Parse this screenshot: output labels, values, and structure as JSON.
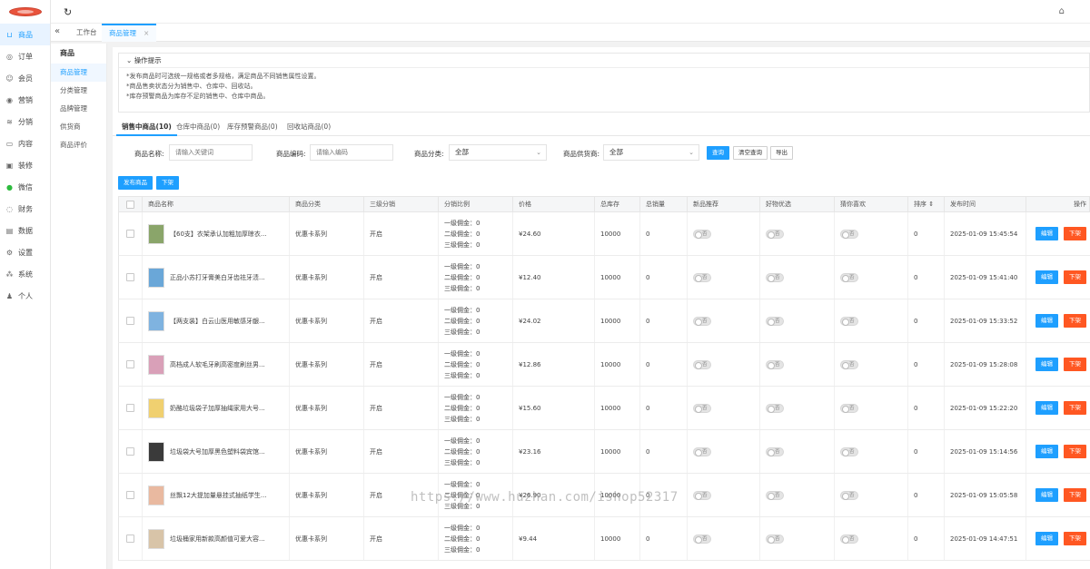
{
  "main_nav": [
    {
      "label": "商品",
      "icon": "cart-icon",
      "active": true
    },
    {
      "label": "订单",
      "icon": "bell-icon"
    },
    {
      "label": "会员",
      "icon": "user-icon"
    },
    {
      "label": "营销",
      "icon": "target-icon"
    },
    {
      "label": "分销",
      "icon": "layers-icon"
    },
    {
      "label": "内容",
      "icon": "book-icon"
    },
    {
      "label": "装修",
      "icon": "monitor-icon"
    },
    {
      "label": "微信",
      "icon": "wechat-icon"
    },
    {
      "label": "财务",
      "icon": "finance-icon"
    },
    {
      "label": "数据",
      "icon": "chart-icon"
    },
    {
      "label": "设置",
      "icon": "gear-icon"
    },
    {
      "label": "系统",
      "icon": "system-icon"
    },
    {
      "label": "个人",
      "icon": "person-icon"
    }
  ],
  "sub_nav": {
    "title": "商品",
    "items": [
      {
        "label": "商品管理",
        "active": true
      },
      {
        "label": "分类管理"
      },
      {
        "label": "品牌管理"
      },
      {
        "label": "供货商"
      },
      {
        "label": "商品评价"
      }
    ]
  },
  "tabs": {
    "home": "工作台",
    "current": "商品管理",
    "close": "×"
  },
  "tips": {
    "title": "操作提示",
    "lines": [
      "*发布商品时可选统一规格或者多规格，满足商品不同销售属性设置。",
      "*商品售卖状态分为销售中、仓库中、回收站。",
      "*库存预警商品为库存不足的销售中、仓库中商品。"
    ]
  },
  "status_tabs": [
    "销售中商品(10)",
    "仓库中商品(0)",
    "库存预警商品(0)",
    "回收站商品(0)"
  ],
  "filters": {
    "name_label": "商品名称:",
    "name_placeholder": "请输入关键词",
    "code_label": "商品编码:",
    "code_placeholder": "请输入编码",
    "category_label": "商品分类:",
    "category_value": "全部",
    "supplier_label": "商品供货商:",
    "supplier_value": "全部",
    "search": "查询",
    "clear": "清空查询",
    "export": "导出"
  },
  "actions": {
    "publish": "发布商品",
    "offshelf": "下架"
  },
  "columns": [
    "商品名称",
    "商品分类",
    "三级分销",
    "分销比例",
    "价格",
    "总库存",
    "总销量",
    "新品推荐",
    "好物优选",
    "猜你喜欢",
    "排序",
    "发布时间",
    "操作"
  ],
  "row_common": {
    "ratio": [
      "一级佣金：0",
      "二级佣金：0",
      "三级佣金：0"
    ],
    "toggle": "否",
    "edit": "编辑",
    "off": "下架"
  },
  "rows": [
    {
      "name": "【60支】衣架承认加粗加厚晾衣...",
      "category": "优惠卡系列",
      "dist": "开启",
      "price": "¥24.60",
      "stock": "10000",
      "sales": "0",
      "sort": "0",
      "time": "2025-01-09 15:45:54",
      "thumb_color": "#8aa56a"
    },
    {
      "name": "正品小苏打牙膏美白牙齿祛牙渍...",
      "category": "优惠卡系列",
      "dist": "开启",
      "price": "¥12.40",
      "stock": "10000",
      "sales": "0",
      "sort": "0",
      "time": "2025-01-09 15:41:40",
      "thumb_color": "#6aa7d8"
    },
    {
      "name": "【两支装】白云山医用敏感牙龈...",
      "category": "优惠卡系列",
      "dist": "开启",
      "price": "¥24.02",
      "stock": "10000",
      "sales": "0",
      "sort": "0",
      "time": "2025-01-09 15:33:52",
      "thumb_color": "#7fb3e0"
    },
    {
      "name": "高档成人软毛牙刷高密度刷丝男...",
      "category": "优惠卡系列",
      "dist": "开启",
      "price": "¥12.86",
      "stock": "10000",
      "sales": "0",
      "sort": "0",
      "time": "2025-01-09 15:28:08",
      "thumb_color": "#d9a0b8"
    },
    {
      "name": "奶酪垃圾袋子加厚抽绳家用大号...",
      "category": "优惠卡系列",
      "dist": "开启",
      "price": "¥15.60",
      "stock": "10000",
      "sales": "0",
      "sort": "0",
      "time": "2025-01-09 15:22:20",
      "thumb_color": "#f0d070"
    },
    {
      "name": "垃圾袋大号加厚黑色塑料袋宾馆...",
      "category": "优惠卡系列",
      "dist": "开启",
      "price": "¥23.16",
      "stock": "10000",
      "sales": "0",
      "sort": "0",
      "time": "2025-01-09 15:14:56",
      "thumb_color": "#3a3a3a"
    },
    {
      "name": "丝飘12大提加量悬挂式抽纸学生...",
      "category": "优惠卡系列",
      "dist": "开启",
      "price": "¥26.90",
      "stock": "10000",
      "sales": "0",
      "sort": "0",
      "time": "2025-01-09 15:05:58",
      "thumb_color": "#e9b9a0"
    },
    {
      "name": "垃圾桶家用新款高颜值可爱大容...",
      "category": "优惠卡系列",
      "dist": "开启",
      "price": "¥9.44",
      "stock": "10000",
      "sales": "0",
      "sort": "0",
      "time": "2025-01-09 14:47:51",
      "thumb_color": "#d8c4a8"
    }
  ],
  "watermark": "https://www.huzhan.com/ishop52317"
}
